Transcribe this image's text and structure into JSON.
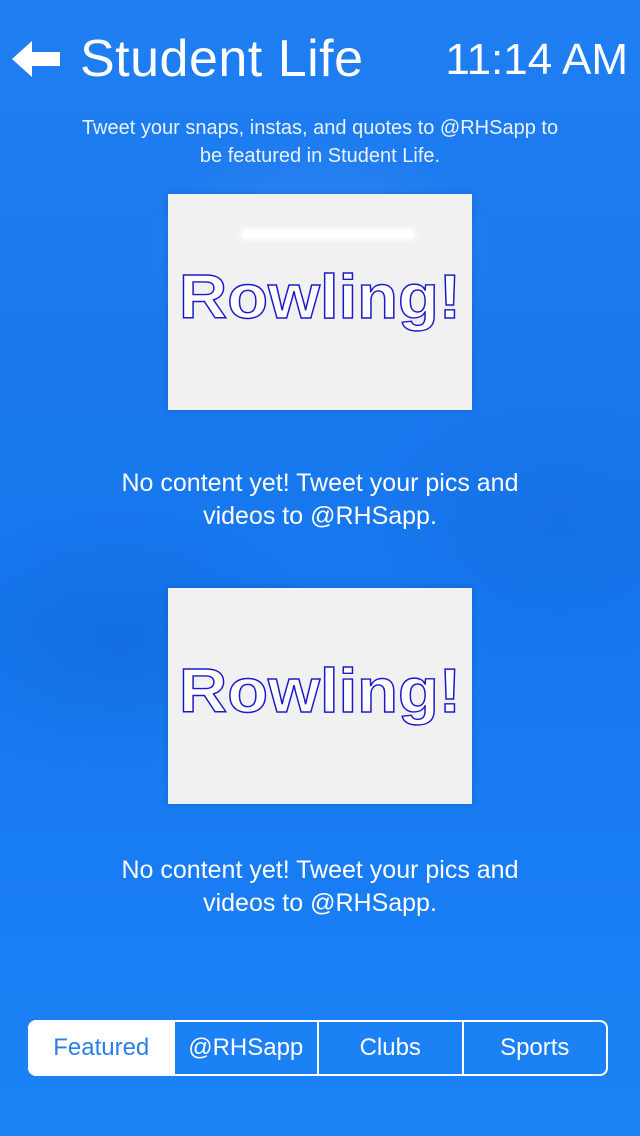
{
  "header": {
    "title": "Student Life",
    "time": "11:14 AM",
    "back_icon": "arrow-left-icon"
  },
  "intro": {
    "line1": "Tweet your snaps, instas, and quotes to @RHSapp to",
    "line2": "be featured in Student Life."
  },
  "feed": [
    {
      "image_text": "Rowling!",
      "message_line1": "No content yet! Tweet your pics and",
      "message_line2": "videos to @RHSapp."
    },
    {
      "image_text": "Rowling!",
      "message_line1": "No content yet! Tweet your pics and",
      "message_line2": "videos to @RHSapp."
    }
  ],
  "tabs": [
    {
      "label": "Featured",
      "selected": true
    },
    {
      "label": "@RHSapp",
      "selected": false
    },
    {
      "label": "Clubs",
      "selected": false
    },
    {
      "label": "Sports",
      "selected": false
    }
  ],
  "colors": {
    "background": "#1a78ee",
    "text": "#ffffff",
    "active_tab_text": "#2b7fe6",
    "logo_outline": "#1a1acc",
    "card": "#f1f1f1"
  }
}
